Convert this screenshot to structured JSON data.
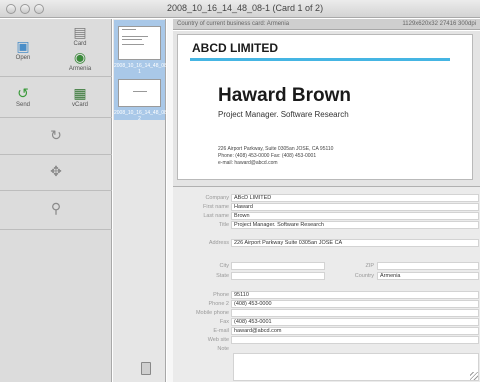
{
  "window": {
    "title": "2008_10_16_14_48_08-1 (Card 1 of 2)"
  },
  "toolbar": {
    "open_label": "Open",
    "card_label": "Card",
    "armenia_label": "Armenia",
    "send_label": "Send",
    "vcard_label": "vCard"
  },
  "thumbnails": {
    "items": [
      {
        "label": "2008_10_16_14_48_08-1"
      },
      {
        "label": "2008_10_16_14_48_08-2"
      }
    ]
  },
  "status": {
    "left": "Country of current business card: Armenia",
    "right": "1129x620x32  27416  300dpi"
  },
  "card": {
    "company": "ABCD LIMITED",
    "name": "Haward Brown",
    "title": "Project Manager. Software Research",
    "address": "226 Airport Parkway, Suite 0305an JOSE, CA 95110",
    "phones": "Phone: (408) 453-0000    Fax: (408) 453-0001",
    "email": "e-mail: haward@abcd.com"
  },
  "form": {
    "labels": {
      "company": "Company",
      "first_name": "First name",
      "last_name": "Last name",
      "title": "Title",
      "address": "Address",
      "city": "City",
      "zip": "ZIP",
      "state": "State",
      "country": "Country",
      "phone": "Phone",
      "phone2": "Phone 2",
      "mobile": "Mobile phone",
      "fax": "Fax",
      "email": "E-mail",
      "web": "Web site",
      "note": "Note"
    },
    "values": {
      "company": "ABcD LIMITED",
      "first_name": "Haward",
      "last_name": "Brown",
      "title": "Project Manager. Software Research",
      "address": "226 Airport Parkway Suite 0305an JOSE CA",
      "city": "",
      "zip": "",
      "state": "",
      "country": "Armenia",
      "phone": "95110",
      "phone2": "(408) 453-0000",
      "mobile": "",
      "fax": "(408) 453-0001",
      "email": "haward@abcd.com",
      "web": ""
    }
  }
}
